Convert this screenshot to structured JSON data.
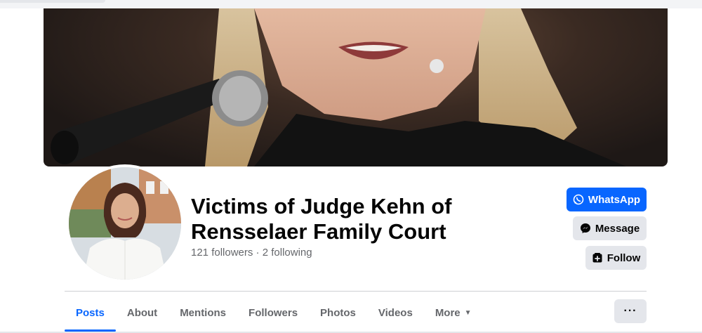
{
  "page": {
    "name": "Victims of Judge Kehn of Rensselaer Family Court",
    "stats": "121 followers · 2 following"
  },
  "actions": {
    "whatsapp_label": "WhatsApp",
    "message_label": "Message",
    "follow_label": "Follow",
    "more_dots": "···"
  },
  "tabs": [
    {
      "label": "Posts",
      "active": true
    },
    {
      "label": "About"
    },
    {
      "label": "Mentions"
    },
    {
      "label": "Followers"
    },
    {
      "label": "Photos"
    },
    {
      "label": "Videos"
    },
    {
      "label": "More"
    }
  ],
  "icons": {
    "whatsapp": "whatsapp-icon",
    "messenger": "messenger-icon",
    "follow": "follow-icon",
    "more_caret": "caret-down-icon"
  },
  "colors": {
    "accent": "#0866ff",
    "secondary_button": "#e4e6eb",
    "text_primary": "#050505",
    "text_secondary": "#65676b"
  }
}
